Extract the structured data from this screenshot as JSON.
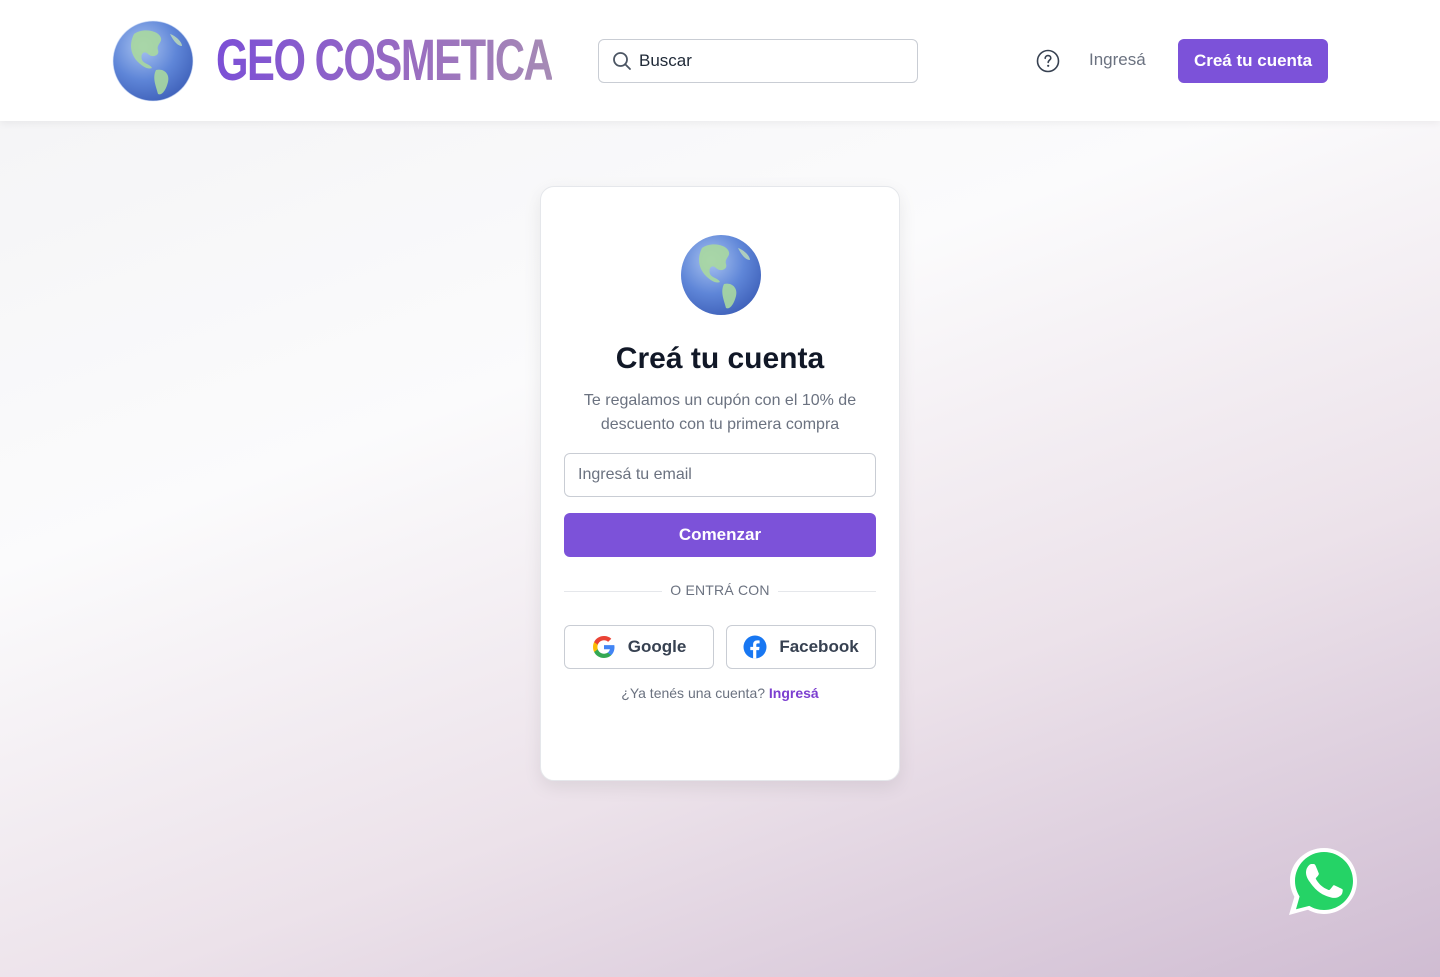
{
  "header": {
    "brand": "GEO COSMETICA",
    "search_placeholder": "Buscar",
    "login_label": "Ingresá",
    "create_account_label": "Creá tu cuenta"
  },
  "card": {
    "title": "Creá tu cuenta",
    "subtitle": "Te regalamos un cupón con el 10% de descuento con tu primera compra",
    "email_placeholder": "Ingresá tu email",
    "start_button": "Comenzar",
    "divider_text": "O ENTRÁ CON",
    "google_label": "Google",
    "facebook_label": "Facebook",
    "have_account_text": "¿Ya tenés una cuenta?",
    "have_account_link": "Ingresá"
  },
  "icons": {
    "logo": "globe-icon",
    "search": "search-icon",
    "help": "help-icon",
    "google": "google-icon",
    "facebook": "facebook-icon",
    "whatsapp": "whatsapp-icon"
  },
  "colors": {
    "accent": "#7c52d9",
    "link": "#7c3fd0",
    "whatsapp": "#25d366"
  }
}
